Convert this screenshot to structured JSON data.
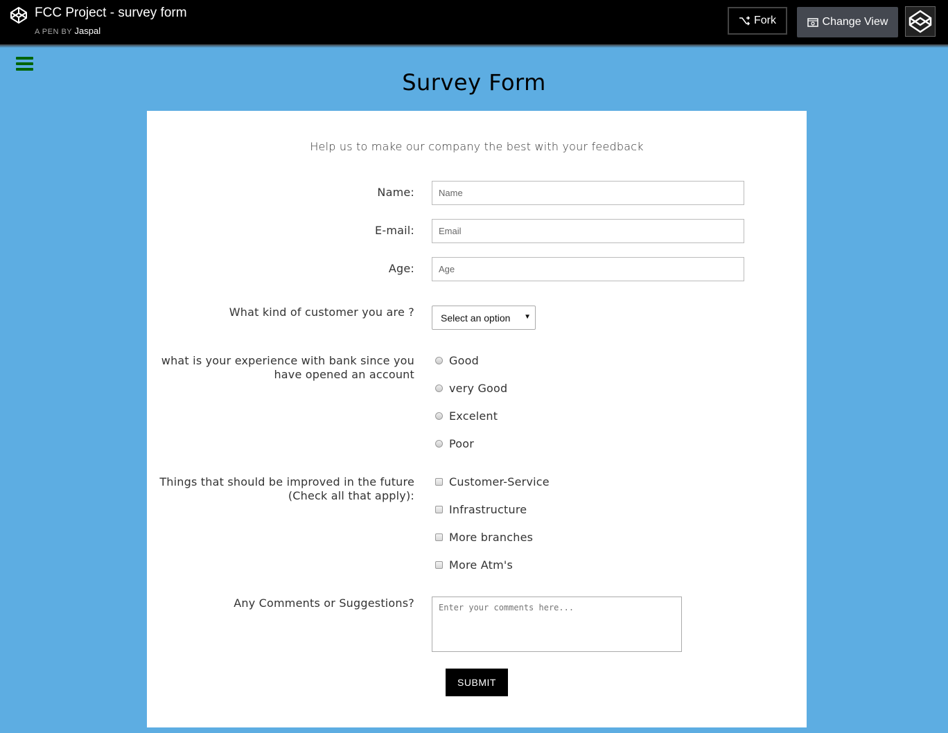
{
  "codepen": {
    "title": "FCC Project - survey form",
    "pen_by": "A PEN BY",
    "author": "Jaspal",
    "fork_label": "Fork",
    "change_view_label": "Change View"
  },
  "page": {
    "title": "Survey Form",
    "description": "Help us to make our company the best with your feedback"
  },
  "form": {
    "name": {
      "label": "Name:",
      "placeholder": "Name"
    },
    "email": {
      "label": "E-mail:",
      "placeholder": "Email"
    },
    "age": {
      "label": "Age:",
      "placeholder": "Age"
    },
    "customer_type": {
      "label": "What kind of customer you are ?",
      "selected": "Select an option"
    },
    "experience": {
      "label_line1": "what is your experience with bank since you",
      "label_line2": "have opened an account",
      "options": [
        "Good",
        "very Good",
        "Excelent",
        "Poor"
      ]
    },
    "improvements": {
      "label_line1": "Things that should be improved in the future",
      "label_line2": "(Check all that apply):",
      "options": [
        "Customer-Service",
        "Infrastructure",
        "More branches",
        "More Atm's"
      ]
    },
    "comments": {
      "label": "Any Comments or Suggestions?",
      "placeholder": "Enter your comments here..."
    },
    "submit_label": "SUBMIT"
  },
  "colors": {
    "background": "#5dade2",
    "hamburger": "#006400",
    "topbar": "#000000"
  }
}
